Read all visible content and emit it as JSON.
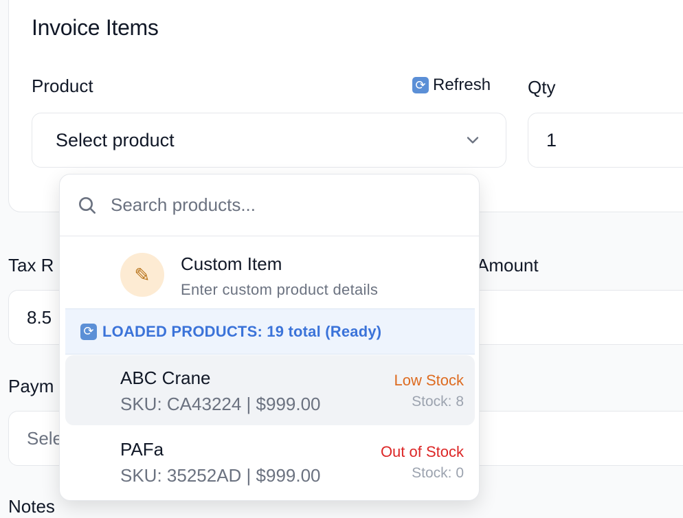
{
  "section": {
    "title": "Invoice Items"
  },
  "product_field": {
    "label": "Product",
    "selected": "Select product"
  },
  "refresh": {
    "label": "Refresh"
  },
  "qty_field": {
    "label": "Qty",
    "value": "1"
  },
  "tax_field": {
    "label": "Tax R",
    "value": "8.5"
  },
  "amount_field": {
    "label": "Amount"
  },
  "payment_field": {
    "label": "Paym",
    "placeholder": "Sele"
  },
  "notes_field": {
    "label": "Notes"
  },
  "dropdown": {
    "search_placeholder": "Search products...",
    "custom_item": {
      "title": "Custom Item",
      "subtitle": "Enter custom product details",
      "icon": "pencil-icon"
    },
    "loaded_banner": "LOADED PRODUCTS: 19 total (Ready)",
    "products": [
      {
        "name": "ABC Crane",
        "meta": "SKU: CA43224 | $999.00",
        "status": "Low Stock",
        "stock": "Stock: 8",
        "status_color": "#dd6b20"
      },
      {
        "name": "PAFa",
        "meta": "SKU: 35252AD | $999.00",
        "status": "Out of Stock",
        "stock": "Stock: 0",
        "status_color": "#dc2626"
      }
    ]
  },
  "colors": {
    "accent": "#3b73d9",
    "low_stock": "#dd6b20",
    "out_of_stock": "#dc2626"
  }
}
